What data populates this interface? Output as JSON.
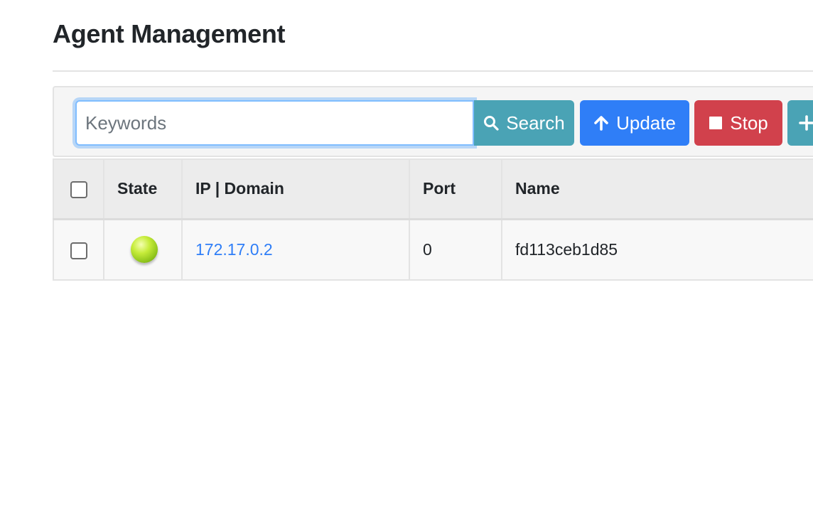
{
  "page": {
    "title": "Agent Management"
  },
  "toolbar": {
    "search": {
      "placeholder": "Keywords",
      "value": ""
    },
    "buttons": {
      "search_label": "Search",
      "update_label": "Update",
      "stop_label": "Stop",
      "add_label": "+"
    }
  },
  "table": {
    "columns": [
      "",
      "State",
      "IP | Domain",
      "Port",
      "Name"
    ],
    "rows": [
      {
        "checked": false,
        "state": "online",
        "ip": "172.17.0.2",
        "port": "0",
        "name": "fd113ceb1d85"
      }
    ]
  },
  "colors": {
    "search_button": "#4aa3b5",
    "update_button": "#2f7ef7",
    "stop_button": "#d1414c",
    "link": "#2f7ef7",
    "state_online": "#a8d82a"
  },
  "icons": {
    "search": "search-icon",
    "update": "arrow-up-icon",
    "stop": "stop-square-icon",
    "add": "plus-icon",
    "state": "status-dot-icon"
  }
}
